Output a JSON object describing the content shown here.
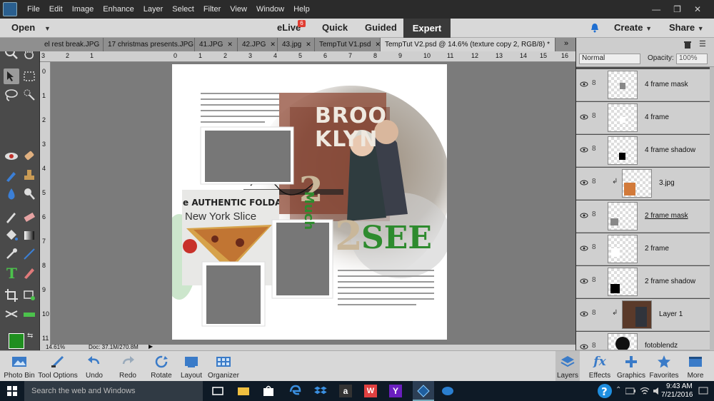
{
  "menu": {
    "items": [
      "File",
      "Edit",
      "Image",
      "Enhance",
      "Layer",
      "Select",
      "Filter",
      "View",
      "Window",
      "Help"
    ]
  },
  "window_controls": {
    "minimize": "—",
    "restore": "❐",
    "close": "✕"
  },
  "modebar": {
    "open_label": "Open",
    "elive_label": "eLive",
    "elive_badge": "6",
    "quick_label": "Quick",
    "guided_label": "Guided",
    "expert_label": "Expert",
    "create_label": "Create",
    "share_label": "Share"
  },
  "tabs": [
    {
      "label": "el rest break.JPG"
    },
    {
      "label": "17 christmas presents.JPG"
    },
    {
      "label": "41.JPG"
    },
    {
      "label": "42.JPG"
    },
    {
      "label": "43.jpg"
    },
    {
      "label": "TempTut V1.psd"
    },
    {
      "label": "TempTut V2.psd @ 14.6% (texture copy 2, RGB/8) *"
    }
  ],
  "tabs_overflow": "»",
  "ruler": {
    "h_ticks": [
      "3",
      "2",
      "1",
      "0",
      "1",
      "2",
      "3",
      "4",
      "5",
      "6",
      "7",
      "8",
      "9",
      "10",
      "11",
      "12",
      "13",
      "14",
      "15",
      "16"
    ],
    "v_ticks": [
      "0",
      "1",
      "2",
      "3",
      "4",
      "5",
      "6",
      "7",
      "8",
      "9",
      "10",
      "11"
    ]
  },
  "document": {
    "title_brooklyn_1": "BROO",
    "title_brooklyn_2": "KLYN",
    "number_top": "2",
    "word_much": "Much",
    "number_bottom": "2",
    "word_see": "SEE",
    "sign_line1": "e AUTHENTIC FOLDABLI",
    "sign_line2": "New York Slice"
  },
  "status": {
    "zoom": "14.61%",
    "doc": "Doc: 37.1M/270.8M"
  },
  "layers_panel": {
    "blend_mode": "Normal",
    "opacity_label": "Opacity:",
    "opacity_value": "100%",
    "layers": [
      {
        "name": "4 frame mask"
      },
      {
        "name": "4 frame"
      },
      {
        "name": "4 frame shadow"
      },
      {
        "name": "3.jpg"
      },
      {
        "name": "2 frame mask"
      },
      {
        "name": "2 frame"
      },
      {
        "name": "2 frame shadow"
      },
      {
        "name": "Layer 1"
      },
      {
        "name": "fotoblendz"
      }
    ]
  },
  "bottombar": {
    "items": [
      "Photo Bin",
      "Tool Options",
      "Undo",
      "Redo",
      "Rotate",
      "Layout",
      "Organizer"
    ],
    "right_items": [
      "Layers",
      "Effects",
      "Graphics",
      "Favorites",
      "More"
    ]
  },
  "taskbar": {
    "search_placeholder": "Search the web and Windows",
    "time": "9:43 AM",
    "date": "7/21/2016"
  },
  "colors": {
    "foreground": "#1f8f1f",
    "background": "#ffffff",
    "accent_green": "#2e8b2e"
  }
}
